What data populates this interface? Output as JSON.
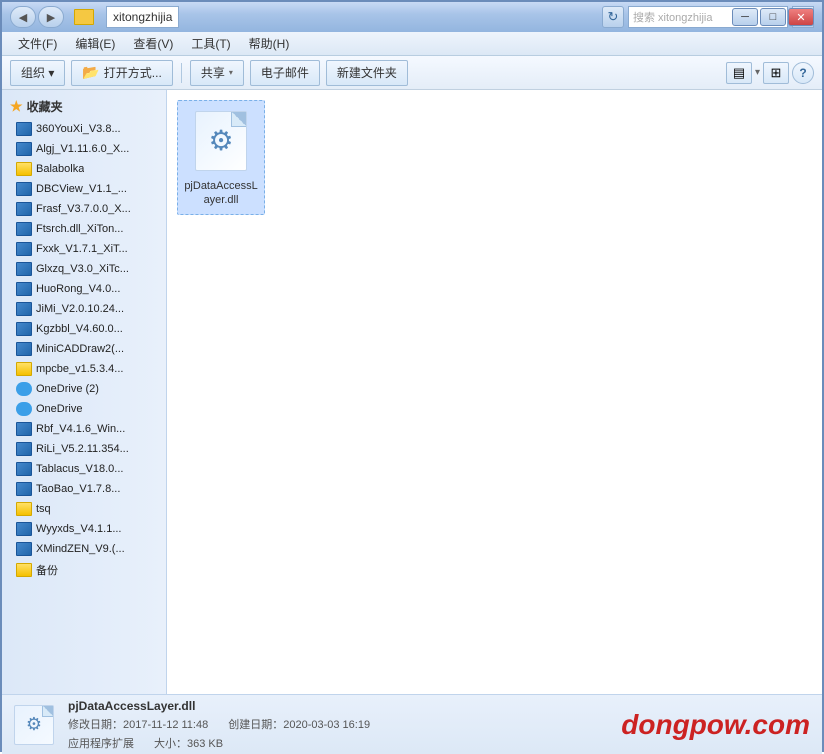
{
  "window": {
    "title": "xitongzhijia",
    "controls": {
      "minimize": "─",
      "maximize": "□",
      "close": "✕"
    }
  },
  "titlebar": {
    "back_label": "◀",
    "forward_label": "▶",
    "path": "xitongzhijia",
    "refresh_label": "↻",
    "search_placeholder": "搜索 xitongzhijia"
  },
  "menubar": {
    "items": [
      "文件(F)",
      "编辑(E)",
      "查看(V)",
      "工具(T)",
      "帮助(H)"
    ]
  },
  "toolbar": {
    "organize_label": "组织 ▾",
    "open_label": "📂 打开方式...",
    "share_label": "共享 ▾",
    "email_label": "电子邮件",
    "new_folder_label": "新建文件夹",
    "view_icon": "≡",
    "columns_icon": "⊞",
    "help_label": "?"
  },
  "sidebar": {
    "favorites_label": "收藏夹",
    "items": [
      {
        "label": "360YouXi_V3.8...",
        "type": "installer"
      },
      {
        "label": "Algj_V1.11.6.0_X...",
        "type": "installer"
      },
      {
        "label": "Balabolka",
        "type": "folder"
      },
      {
        "label": "DBCView_V1.1_...",
        "type": "installer"
      },
      {
        "label": "Frasf_V3.7.0.0_X...",
        "type": "installer"
      },
      {
        "label": "Ftsrch.dll_XiTon...",
        "type": "installer"
      },
      {
        "label": "Fxxk_V1.7.1_XiT...",
        "type": "installer"
      },
      {
        "label": "Glxzq_V3.0_XiTc...",
        "type": "installer"
      },
      {
        "label": "HuoRong_V4.0...",
        "type": "installer"
      },
      {
        "label": "JiMi_V2.0.10.24...",
        "type": "installer"
      },
      {
        "label": "Kgzbbl_V4.60.0...",
        "type": "installer"
      },
      {
        "label": "MiniCADDraw2(...",
        "type": "installer"
      },
      {
        "label": "mpcbe_v1.5.3.4...",
        "type": "folder"
      },
      {
        "label": "OneDrive (2)",
        "type": "cloud"
      },
      {
        "label": "OneDrive",
        "type": "cloud"
      },
      {
        "label": "Rbf_V4.1.6_Win...",
        "type": "installer"
      },
      {
        "label": "RiLi_V5.2.11.354...",
        "type": "installer"
      },
      {
        "label": "Tablacus_V18.0...",
        "type": "installer"
      },
      {
        "label": "TaoBao_V1.7.8...",
        "type": "installer"
      },
      {
        "label": "tsq",
        "type": "folder"
      },
      {
        "label": "Wyyxds_V4.1.1...",
        "type": "installer"
      },
      {
        "label": "XMindZEN_V9.(...",
        "type": "installer"
      },
      {
        "label": "备份",
        "type": "folder"
      }
    ]
  },
  "file_area": {
    "file": {
      "name": "pjDataAccessLayer.dll",
      "icon": "⚙"
    }
  },
  "statusbar": {
    "filename": "pjDataAccessLayer.dll",
    "modified_label": "修改日期:",
    "modified_date": "2017-11-12 11:48",
    "created_label": "创建日期:",
    "created_date": "2020-03-03 16:19",
    "type_label": "应用程序扩展",
    "size_label": "大小：",
    "size_value": "363 KB",
    "gear_icon": "⚙"
  },
  "watermark": {
    "text": "dongpow.com"
  }
}
